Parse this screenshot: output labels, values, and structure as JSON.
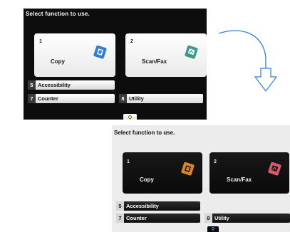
{
  "screens": {
    "before": {
      "title": "Select function to use.",
      "tiles": [
        {
          "number": "1",
          "label": "Copy",
          "icon": "copy-icon"
        },
        {
          "number": "2",
          "label": "Scan/Fax",
          "icon": "scan-fax-icon"
        }
      ],
      "rows": [
        {
          "number": "5",
          "label": "Accessibility"
        },
        {
          "number": "7",
          "label": "Counter"
        },
        {
          "number": "8",
          "label": "Utility"
        }
      ],
      "key_icon": "key-icon"
    },
    "after": {
      "title": "Select function to use.",
      "tiles": [
        {
          "number": "1",
          "label": "Copy",
          "icon": "copy-icon"
        },
        {
          "number": "2",
          "label": "Scan/Fax",
          "icon": "scan-fax-icon"
        }
      ],
      "rows": [
        {
          "number": "5",
          "label": "Accessibility"
        },
        {
          "number": "7",
          "label": "Counter"
        },
        {
          "number": "8",
          "label": "Utility"
        }
      ],
      "key_icon": "key-icon"
    }
  },
  "arrow_icon": "curved-down-arrow-icon",
  "colors": {
    "dark_background": "#0d0d0d",
    "light_background": "#ececec",
    "copy_icon_before": "#2f7fd6",
    "scan_icon_before": "#3a9a8c",
    "copy_icon_after": "#d9852a",
    "scan_icon_after": "#d95a6a",
    "arrow": "#2f7fd6"
  }
}
